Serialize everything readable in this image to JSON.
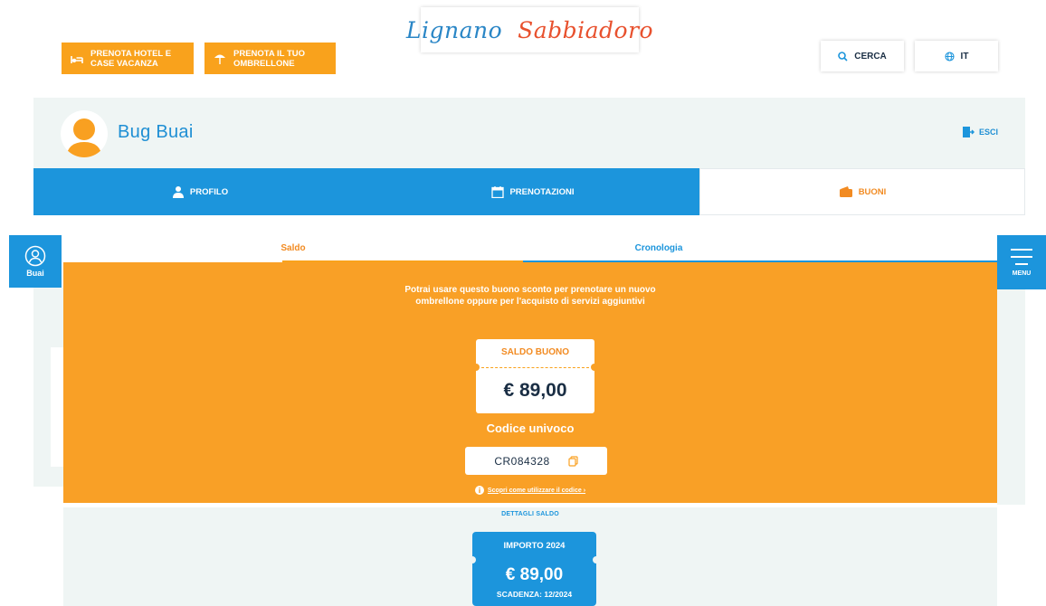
{
  "header": {
    "hotel_button": "PRENOTA HOTEL E CASE VACANZA",
    "umbrella_button": "PRENOTA IL TUO OMBRELLONE",
    "logo_part1": "Lignano",
    "logo_part2": "Sabbiadoro",
    "search_label": "CERCA",
    "language_label": "IT"
  },
  "user": {
    "name": "Bug Buai",
    "logout_label": "ESCI",
    "side_label": "Buai"
  },
  "main_tabs": [
    {
      "label": "PROFILO",
      "icon": "person-icon"
    },
    {
      "label": "PRENOTAZIONI",
      "icon": "calendar-icon"
    },
    {
      "label": "BUONI",
      "icon": "wallet-icon",
      "active": true
    }
  ],
  "side_menu": {
    "label": "MENU"
  },
  "sub_tabs": [
    {
      "label": "Saldo",
      "active": true
    },
    {
      "label": "Cronologia"
    }
  ],
  "voucher": {
    "intro": "Potrai usare questo buono sconto per prenotare un nuovo ombrellone oppure per l'acquisto di servizi aggiuntivi",
    "balance_label": "SALDO BUONO",
    "balance_amount": "€ 89,00",
    "code_label": "Codice univoco",
    "code": "CR084328",
    "howto_link": "Scopri come utilizzare il codice ›"
  },
  "details": {
    "title": "DETTAGLI SALDO",
    "card_label": "IMPORTO 2024",
    "card_amount": "€ 89,00",
    "card_expiry": "SCADENZA: 12/2024"
  },
  "colors": {
    "orange": "#f9a026",
    "blue": "#1c95dc",
    "light_bg": "#eff5f4"
  }
}
